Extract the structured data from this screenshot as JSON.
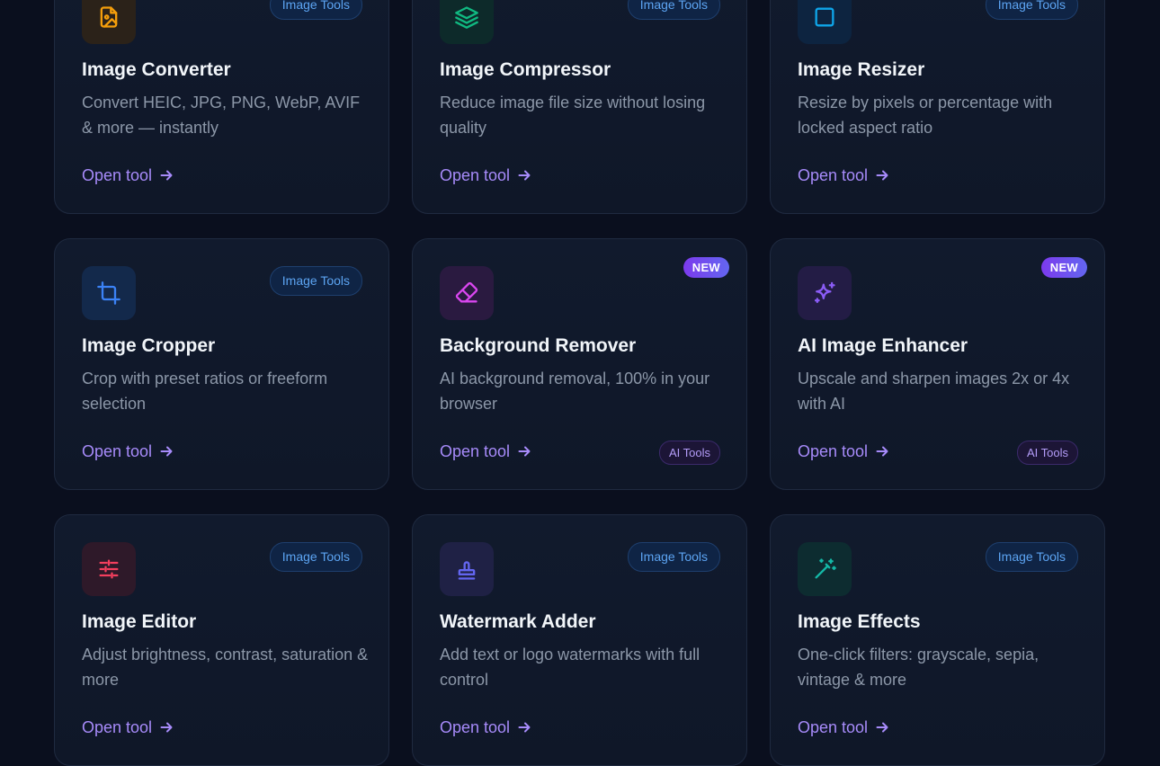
{
  "cards": [
    {
      "title": "Image Converter",
      "description": "Convert HEIC, JPG, PNG, WebP, AVIF & more — instantly",
      "category": "Image Tools",
      "link": "Open tool",
      "icon": "file-image-icon",
      "icon_color": "#f59e0b",
      "icon_bg": "#2b2219"
    },
    {
      "title": "Image Compressor",
      "description": "Reduce image file size without losing quality",
      "category": "Image Tools",
      "link": "Open tool",
      "icon": "layers-icon",
      "icon_color": "#10b981",
      "icon_bg": "#0d2a2a"
    },
    {
      "title": "Image Resizer",
      "description": "Resize by pixels or percentage with locked aspect ratio",
      "category": "Image Tools",
      "link": "Open tool",
      "icon": "square-icon",
      "icon_color": "#0ea5e9",
      "icon_bg": "#0d2440"
    },
    {
      "title": "Image Cropper",
      "description": "Crop with preset ratios or freeform selection",
      "category": "Image Tools",
      "link": "Open tool",
      "icon": "crop-icon",
      "icon_color": "#3b82f6",
      "icon_bg": "#13294b"
    },
    {
      "title": "Background Remover",
      "description": "AI background removal, 100% in your browser",
      "badge": "NEW",
      "ai_badge": "AI Tools",
      "link": "Open tool",
      "icon": "eraser-icon",
      "icon_color": "#d946ef",
      "icon_bg": "#2a1a40"
    },
    {
      "title": "AI Image Enhancer",
      "description": "Upscale and sharpen images 2x or 4x with AI",
      "badge": "NEW",
      "ai_badge": "AI Tools",
      "link": "Open tool",
      "icon": "sparkles-icon",
      "icon_color": "#8b5cf6",
      "icon_bg": "#231c45"
    },
    {
      "title": "Image Editor",
      "description": "Adjust brightness, contrast, saturation & more",
      "category": "Image Tools",
      "link": "Open tool",
      "icon": "sliders-icon",
      "icon_color": "#f43f5e",
      "icon_bg": "#2e1929"
    },
    {
      "title": "Watermark Adder",
      "description": "Add text or logo watermarks with full control",
      "category": "Image Tools",
      "link": "Open tool",
      "icon": "stamp-icon",
      "icon_color": "#6366f1",
      "icon_bg": "#1f2145"
    },
    {
      "title": "Image Effects",
      "description": "One-click filters: grayscale, sepia, vintage & more",
      "category": "Image Tools",
      "link": "Open tool",
      "icon": "magic-wand-icon",
      "icon_color": "#14b8a6",
      "icon_bg": "#0d2c30"
    }
  ]
}
